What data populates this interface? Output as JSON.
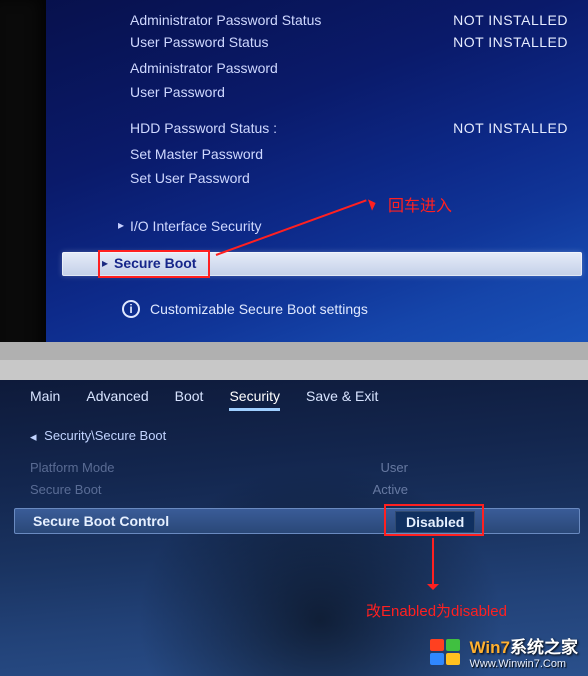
{
  "annotations": {
    "enter_text": "回车进入",
    "change_text": "改Enabled为disabled"
  },
  "top_screen": {
    "rows": [
      {
        "label": "Administrator Password Status",
        "value": "NOT INSTALLED"
      },
      {
        "label": "User Password Status",
        "value": "NOT INSTALLED"
      },
      {
        "label": "Administrator Password",
        "value": ""
      },
      {
        "label": "User Password",
        "value": ""
      },
      {
        "label": "HDD Password Status  :",
        "value": "NOT INSTALLED"
      },
      {
        "label": "Set Master Password",
        "value": ""
      },
      {
        "label": "Set User Password",
        "value": ""
      },
      {
        "label": "I/O Interface Security",
        "value": ""
      }
    ],
    "selected": {
      "label": "Secure Boot"
    },
    "info": "Customizable Secure Boot settings"
  },
  "bottom_screen": {
    "tabs": [
      "Main",
      "Advanced",
      "Boot",
      "Security",
      "Save & Exit"
    ],
    "active_tab": "Security",
    "breadcrumb": "Security\\Secure Boot",
    "rows": [
      {
        "label": "Platform Mode",
        "value": "User"
      },
      {
        "label": "Secure Boot",
        "value": "Active"
      }
    ],
    "selected": {
      "label": "Secure Boot Control",
      "value": "Disabled"
    }
  },
  "watermark": {
    "line1_a": "Win7",
    "line1_b": "系统之家",
    "line2": "Www.Winwin7.Com"
  }
}
